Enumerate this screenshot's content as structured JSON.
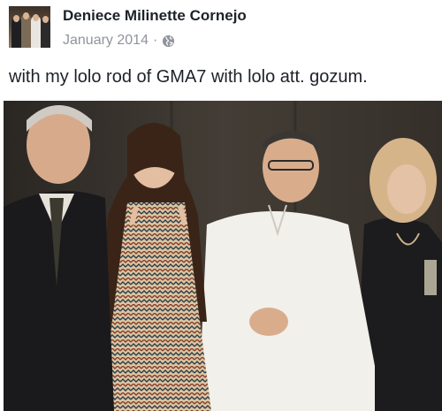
{
  "post": {
    "author": "Deniece Milinette Cornejo",
    "date": "January 2014",
    "separator": "·",
    "privacy_icon": "globe-icon",
    "text": "with my lolo rod of GMA7 with lolo att. gozum."
  }
}
